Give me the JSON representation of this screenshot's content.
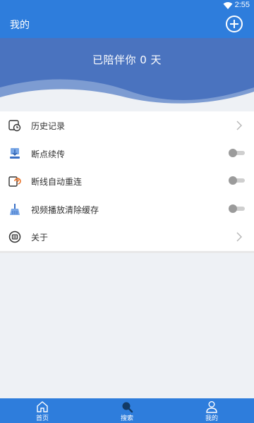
{
  "status_bar": {
    "time": "2:55",
    "icons": [
      "wifi-icon",
      "battery-icon"
    ]
  },
  "app_bar": {
    "title": "我的",
    "action_icon": "add-circle-icon"
  },
  "hero": {
    "text": "已陪伴你 0 天"
  },
  "menu": {
    "items": [
      {
        "label": "历史记录",
        "icon": "history-icon",
        "control": "chevron"
      },
      {
        "label": "断点续传",
        "icon": "download-icon",
        "control": "toggle",
        "enabled": false
      },
      {
        "label": "断线自动重连",
        "icon": "reconnect-icon",
        "control": "toggle",
        "enabled": false
      },
      {
        "label": "视频播放清除缓存",
        "icon": "broom-icon",
        "control": "toggle",
        "enabled": false
      },
      {
        "label": "关于",
        "icon": "about-icon",
        "control": "chevron"
      }
    ]
  },
  "bottom_nav": {
    "items": [
      {
        "label": "首页",
        "icon": "home-icon"
      },
      {
        "label": "搜索",
        "icon": "search-icon"
      },
      {
        "label": "我的",
        "icon": "person-icon"
      }
    ]
  },
  "colors": {
    "primary": "#2e7ddc",
    "hero": "#4a73bf",
    "background": "#eef1f5"
  }
}
